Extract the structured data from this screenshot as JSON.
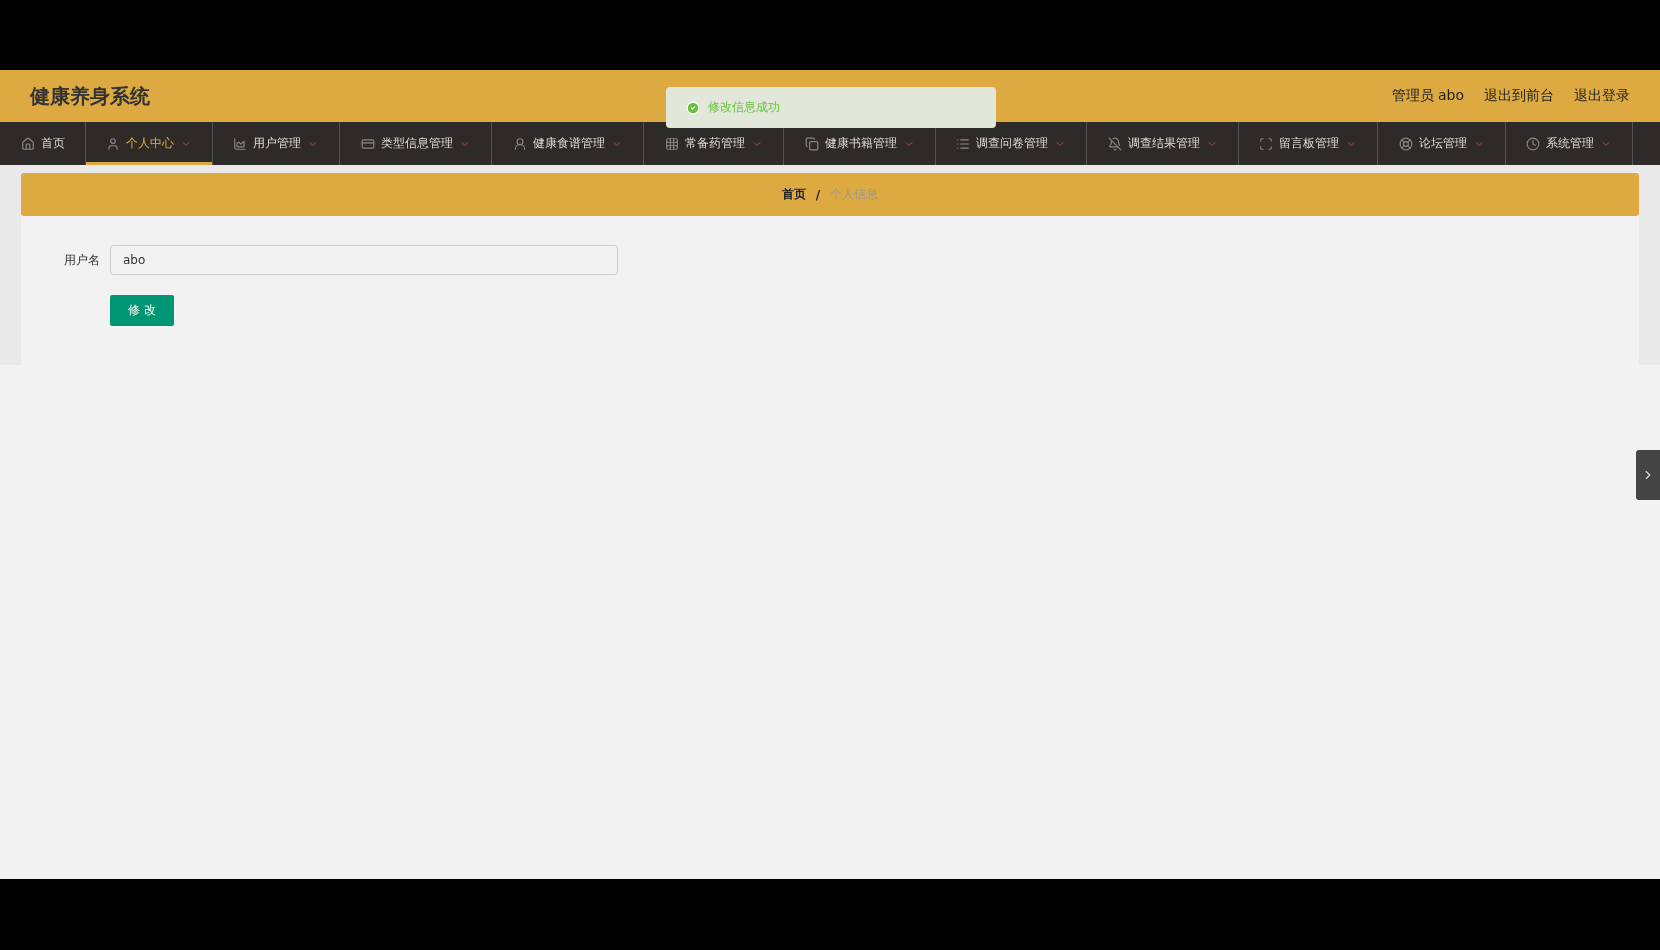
{
  "header": {
    "title": "健康养身系统",
    "links": [
      "管理员 abo",
      "退出到前台",
      "退出登录"
    ]
  },
  "toast": {
    "message": "修改信息成功"
  },
  "nav": [
    {
      "label": "首页",
      "selected": false,
      "dropdown": false
    },
    {
      "label": "个人中心",
      "selected": true,
      "dropdown": true
    },
    {
      "label": "用户管理",
      "selected": false,
      "dropdown": true
    },
    {
      "label": "类型信息管理",
      "selected": false,
      "dropdown": true
    },
    {
      "label": "健康食谱管理",
      "selected": false,
      "dropdown": true
    },
    {
      "label": "常备药管理",
      "selected": false,
      "dropdown": true
    },
    {
      "label": "健康书籍管理",
      "selected": false,
      "dropdown": true
    },
    {
      "label": "调查问卷管理",
      "selected": false,
      "dropdown": true
    },
    {
      "label": "调查结果管理",
      "selected": false,
      "dropdown": true
    },
    {
      "label": "留言板管理",
      "selected": false,
      "dropdown": true
    },
    {
      "label": "论坛管理",
      "selected": false,
      "dropdown": true
    },
    {
      "label": "系统管理",
      "selected": false,
      "dropdown": true
    }
  ],
  "breadcrumb": {
    "home": "首页",
    "separator": "/",
    "current": "个人信息"
  },
  "form": {
    "fields": [
      {
        "label": "用户名",
        "value": "abo"
      }
    ],
    "submit": "修 改"
  }
}
